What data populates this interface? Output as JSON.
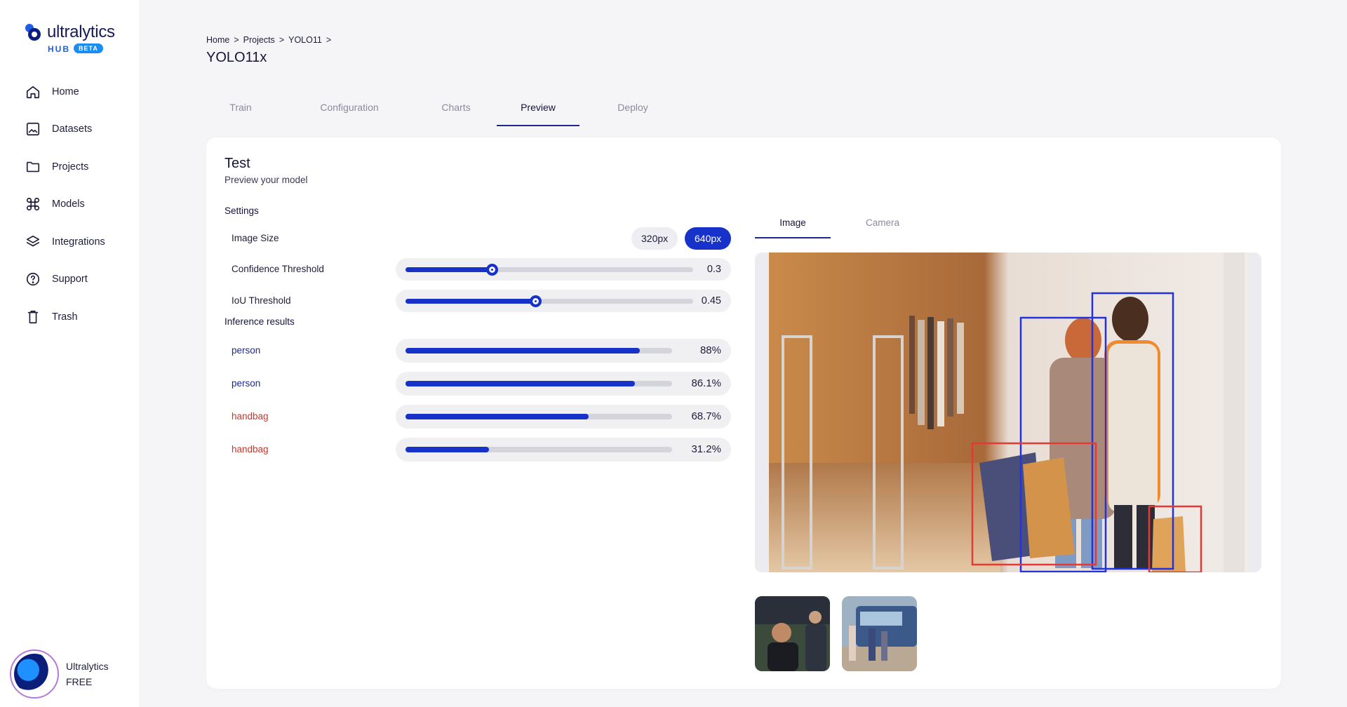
{
  "brand": {
    "name": "ultralytics",
    "hub": "HUB",
    "badge": "BETA"
  },
  "sidebar": {
    "items": [
      {
        "label": "Home",
        "icon": "home-icon"
      },
      {
        "label": "Datasets",
        "icon": "image-icon"
      },
      {
        "label": "Projects",
        "icon": "folder-icon"
      },
      {
        "label": "Models",
        "icon": "command-icon"
      },
      {
        "label": "Integrations",
        "icon": "layers-icon"
      },
      {
        "label": "Support",
        "icon": "help-icon"
      },
      {
        "label": "Trash",
        "icon": "trash-icon"
      }
    ],
    "user": {
      "name": "Ultralytics",
      "plan": "FREE"
    }
  },
  "breadcrumb": [
    "Home",
    "Projects",
    "YOLO11"
  ],
  "page_title": "YOLO11x",
  "tabs": [
    "Train",
    "Configuration",
    "Charts",
    "Preview",
    "Deploy"
  ],
  "active_tab": "Preview",
  "test": {
    "title": "Test",
    "subtitle": "Preview your model",
    "settings_label": "Settings",
    "image_size_label": "Image Size",
    "image_sizes": [
      "320px",
      "640px"
    ],
    "selected_size": "640px",
    "confidence": {
      "label": "Confidence Threshold",
      "value": 0.3,
      "display": "0.3"
    },
    "iou": {
      "label": "IoU Threshold",
      "value": 0.45,
      "display": "0.45"
    },
    "results_label": "Inference results",
    "results": [
      {
        "label": "person",
        "score": 0.88,
        "display": "88%"
      },
      {
        "label": "person",
        "score": 0.861,
        "display": "86.1%"
      },
      {
        "label": "handbag",
        "score": 0.687,
        "display": "68.7%"
      },
      {
        "label": "handbag",
        "score": 0.312,
        "display": "31.2%"
      }
    ]
  },
  "preview_tabs": [
    "Image",
    "Camera"
  ],
  "active_preview_tab": "Image",
  "colors": {
    "accent": "#1732c8",
    "person_box": "#2233dd",
    "handbag_box": "#e53935"
  }
}
